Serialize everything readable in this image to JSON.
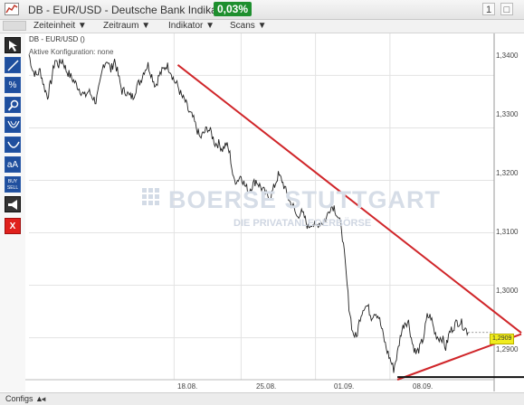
{
  "window": {
    "title": "DB - EUR/USD - Deutsche Bank Indikation",
    "change_badge": "0,03%",
    "pin_label": "1",
    "close_label": "□"
  },
  "toolbar": {
    "menus": [
      {
        "label": "Zeiteinheit ▼"
      },
      {
        "label": "Zeitraum ▼"
      },
      {
        "label": "Indikator ▼"
      },
      {
        "label": "Scans ▼"
      }
    ]
  },
  "sidebar": {
    "tools": [
      {
        "icon": "cursor-arrow-icon",
        "label": ""
      },
      {
        "icon": "trendline-icon",
        "label": ""
      },
      {
        "icon": "percent-icon",
        "label": "%"
      },
      {
        "icon": "magnifier-icon",
        "label": ""
      },
      {
        "icon": "fibonacci-arc-icon",
        "label": ""
      },
      {
        "icon": "curve-icon",
        "label": ""
      },
      {
        "icon": "text-icon",
        "label": "aA"
      },
      {
        "icon": "buy-sell-icon",
        "label": "BUY SELL"
      },
      {
        "icon": "megaphone-icon",
        "label": ""
      },
      {
        "icon": "delete-icon",
        "label": "X"
      }
    ]
  },
  "legend": {
    "series": "DB - EUR/USD ()",
    "config": "Aktive Konfiguration: none"
  },
  "watermark": {
    "main": "BOERSE STUTTGART",
    "sub": "DIE PRIVATANLEGERBÖRSE"
  },
  "price_tag": "1,2909",
  "footer": {
    "configs_label": "Configs ▲",
    "scroll_left": "◄"
  },
  "colors": {
    "price_line": "#222222",
    "trend_lines": "#d0262a",
    "support_line": "#111111",
    "badge": "#1e8f2e",
    "tool_bg": "#1f4f9e",
    "delete_bg": "#e0201c"
  },
  "chart_data": {
    "type": "line",
    "title": "",
    "xlabel": "",
    "ylabel": "",
    "ylim": [
      1.282,
      1.348
    ],
    "x_tick_labels": [
      "18.08.",
      "25.08.",
      "01.09.",
      "08.09."
    ],
    "y_tick_labels": [
      "1,3400",
      "1,3300",
      "1,3200",
      "1,3100",
      "1,3000",
      "1,2900"
    ],
    "y_tick_values": [
      1.34,
      1.33,
      1.32,
      1.31,
      1.3,
      1.29
    ],
    "x_tick_index": [
      39,
      57,
      77,
      97
    ],
    "series": [
      {
        "values": [
          1.344,
          1.341,
          1.34,
          1.341,
          1.338,
          1.336,
          1.339,
          1.343,
          1.342,
          1.343,
          1.341,
          1.34,
          1.339,
          1.338,
          1.337,
          1.336,
          1.337,
          1.336,
          1.335,
          1.338,
          1.342,
          1.343,
          1.341,
          1.343,
          1.34,
          1.337,
          1.337,
          1.336,
          1.336,
          1.338,
          1.339,
          1.341,
          1.342,
          1.34,
          1.338,
          1.34,
          1.341,
          1.342,
          1.341,
          1.339,
          1.338,
          1.336,
          1.335,
          1.333,
          1.332,
          1.33,
          1.328,
          1.329,
          1.33,
          1.329,
          1.327,
          1.327,
          1.326,
          1.327,
          1.325,
          1.32,
          1.32,
          1.321,
          1.319,
          1.318,
          1.319,
          1.32,
          1.319,
          1.318,
          1.317,
          1.317,
          1.319,
          1.321,
          1.32,
          1.318,
          1.316,
          1.315,
          1.313,
          1.314,
          1.313,
          1.311,
          1.312,
          1.311,
          1.312,
          1.312,
          1.313,
          1.315,
          1.315,
          1.313,
          1.311,
          1.304,
          1.296,
          1.291,
          1.29,
          1.294,
          1.296,
          1.296,
          1.294,
          1.295,
          1.294,
          1.291,
          1.288,
          1.286,
          1.284,
          1.287,
          1.291,
          1.293,
          1.293,
          1.289,
          1.287,
          1.288,
          1.29,
          1.294,
          1.294,
          1.291,
          1.29,
          1.29,
          1.288,
          1.291,
          1.292,
          1.293,
          1.293,
          1.292,
          1.291
        ]
      }
    ],
    "trend_lines": [
      {
        "name": "",
        "from": {
          "index": 40,
          "value": 1.342
        },
        "to": {
          "index": 125,
          "value": 1.293
        }
      },
      {
        "name": "",
        "from": {
          "index": 99,
          "value": 1.282
        },
        "to": {
          "index": 125,
          "value": 1.29
        }
      }
    ],
    "support_line": {
      "from": {
        "index": 99,
        "value": 1.2825
      },
      "to": {
        "index": 125,
        "value": 1.2825
      }
    },
    "grid": true,
    "legend": "top-left"
  }
}
